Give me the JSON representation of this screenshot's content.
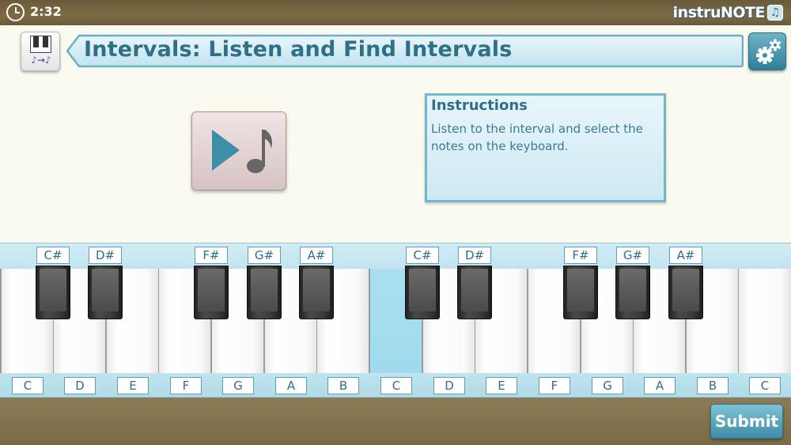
{
  "status_bar": {
    "time": "2:32",
    "brand": "instruNOTE",
    "brand_icon": "music-note-icon"
  },
  "header": {
    "title": "Intervals:  Listen and Find Intervals"
  },
  "instructions": {
    "title": "Instructions",
    "body": "Listen to the interval and select the notes on the keyboard."
  },
  "keyboard": {
    "black_labels": [
      "C#",
      "D#",
      "F#",
      "G#",
      "A#",
      "C#",
      "D#",
      "F#",
      "G#",
      "A#"
    ],
    "white_labels": [
      "C",
      "D",
      "E",
      "F",
      "G",
      "A",
      "B",
      "C",
      "D",
      "E",
      "F",
      "G",
      "A",
      "B",
      "C"
    ],
    "selected_white_key": "C"
  },
  "submit_label": "Submit",
  "colors": {
    "accent": "#2f6f87",
    "banner": "#cfeaf3",
    "selected_key": "#a5ddef",
    "frame": "#7d6a45"
  }
}
